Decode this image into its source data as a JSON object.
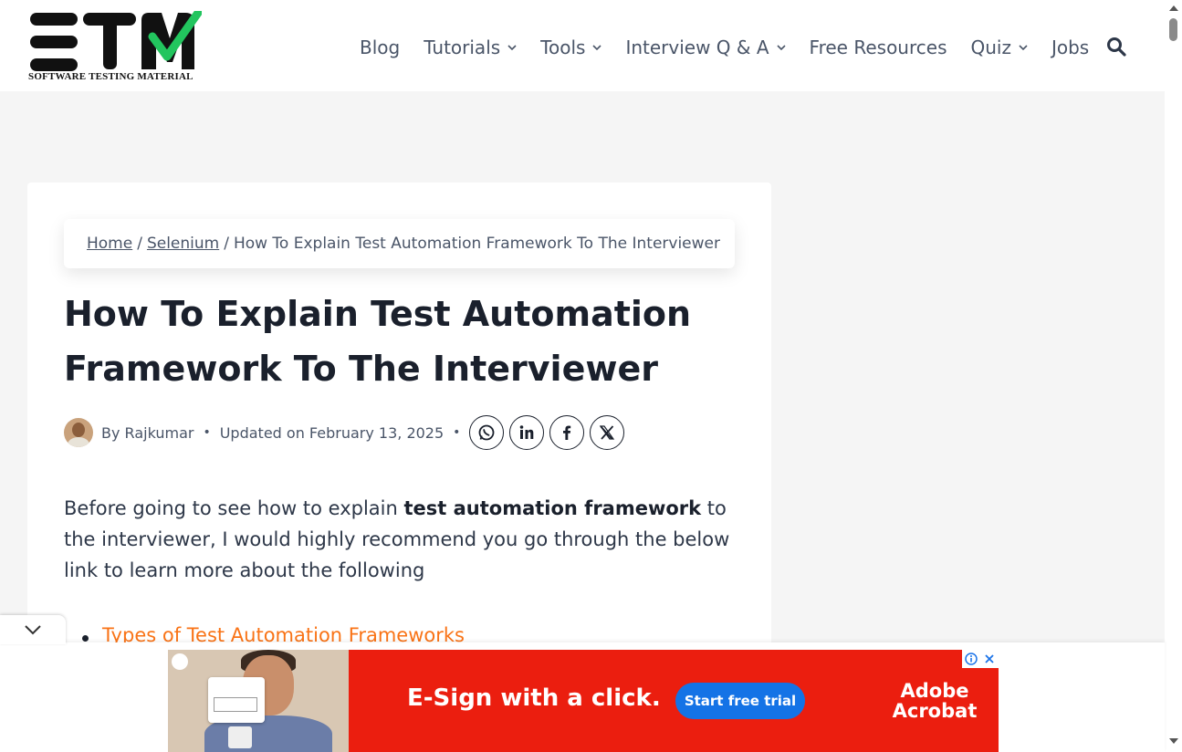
{
  "logo": {
    "letters": "STM",
    "subtitle": "SOFTWARE TESTING MATERIAL"
  },
  "nav": {
    "items": [
      {
        "label": "Blog",
        "dropdown": false
      },
      {
        "label": "Tutorials",
        "dropdown": true
      },
      {
        "label": "Tools",
        "dropdown": true
      },
      {
        "label": "Interview Q & A",
        "dropdown": true
      },
      {
        "label": "Free Resources",
        "dropdown": false
      },
      {
        "label": "Quiz",
        "dropdown": true
      },
      {
        "label": "Jobs",
        "dropdown": false
      }
    ],
    "search_icon": "search-icon"
  },
  "breadcrumb": {
    "home": "Home",
    "category": "Selenium",
    "current": "How To Explain Test Automation Framework To The Interviewer",
    "separator": "/"
  },
  "article": {
    "title": "How To Explain Test Automation Framework To The Interviewer",
    "author_prefix": "By",
    "author": "Rajkumar",
    "updated": "Updated on February 13, 2025",
    "share_icons": [
      "whatsapp-icon",
      "linkedin-icon",
      "facebook-icon",
      "x-icon"
    ],
    "intro_before": "Before going to see how to explain ",
    "intro_bold": "test automation framework",
    "intro_after": " to the interviewer, I would highly recommend you go through the below link to learn more about the following",
    "links": [
      "Types of Test Automation Frameworks"
    ]
  },
  "ad": {
    "headline": "E-Sign with a click.",
    "cta": "Start free trial",
    "brand_line1": "Adobe",
    "brand_line2": "Acrobat",
    "background": "#eb1e0f",
    "cta_color": "#1473e6"
  },
  "colors": {
    "link_accent": "#f97316",
    "logo_check": "#22c55e"
  }
}
